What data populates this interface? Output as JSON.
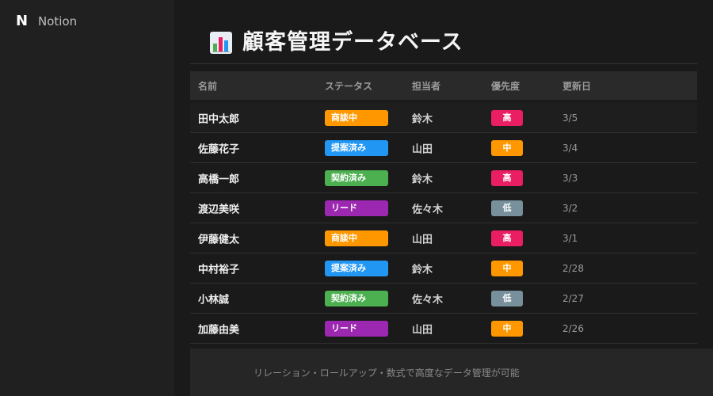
{
  "sidebar": {
    "logo": "N",
    "app_name": "Notion"
  },
  "page": {
    "icon": "bar-chart-icon",
    "title": "顧客管理データベース"
  },
  "table": {
    "columns": [
      "名前",
      "ステータス",
      "担当者",
      "優先度",
      "更新日"
    ],
    "rows": [
      {
        "name": "田中太郎",
        "status": "商談中",
        "owner": "鈴木",
        "priority": "高",
        "updated": "3/5"
      },
      {
        "name": "佐藤花子",
        "status": "提案済み",
        "owner": "山田",
        "priority": "中",
        "updated": "3/4"
      },
      {
        "name": "高橋一郎",
        "status": "契約済み",
        "owner": "鈴木",
        "priority": "高",
        "updated": "3/3"
      },
      {
        "name": "渡辺美咲",
        "status": "リード",
        "owner": "佐々木",
        "priority": "低",
        "updated": "3/2"
      },
      {
        "name": "伊藤健太",
        "status": "商談中",
        "owner": "山田",
        "priority": "高",
        "updated": "3/1"
      },
      {
        "name": "中村裕子",
        "status": "提案済み",
        "owner": "鈴木",
        "priority": "中",
        "updated": "2/28"
      },
      {
        "name": "小林誠",
        "status": "契約済み",
        "owner": "佐々木",
        "priority": "低",
        "updated": "2/27"
      },
      {
        "name": "加藤由美",
        "status": "リード",
        "owner": "山田",
        "priority": "中",
        "updated": "2/26"
      }
    ]
  },
  "status_colors": {
    "商談中": "#ff9800",
    "提案済み": "#2196f3",
    "契約済み": "#4caf50",
    "リード": "#9c27b0"
  },
  "priority_colors": {
    "高": "#e91e63",
    "中": "#ff9800",
    "低": "#78909c"
  },
  "footer": {
    "note": "リレーション・ロールアップ・数式で高度なデータ管理が可能"
  }
}
